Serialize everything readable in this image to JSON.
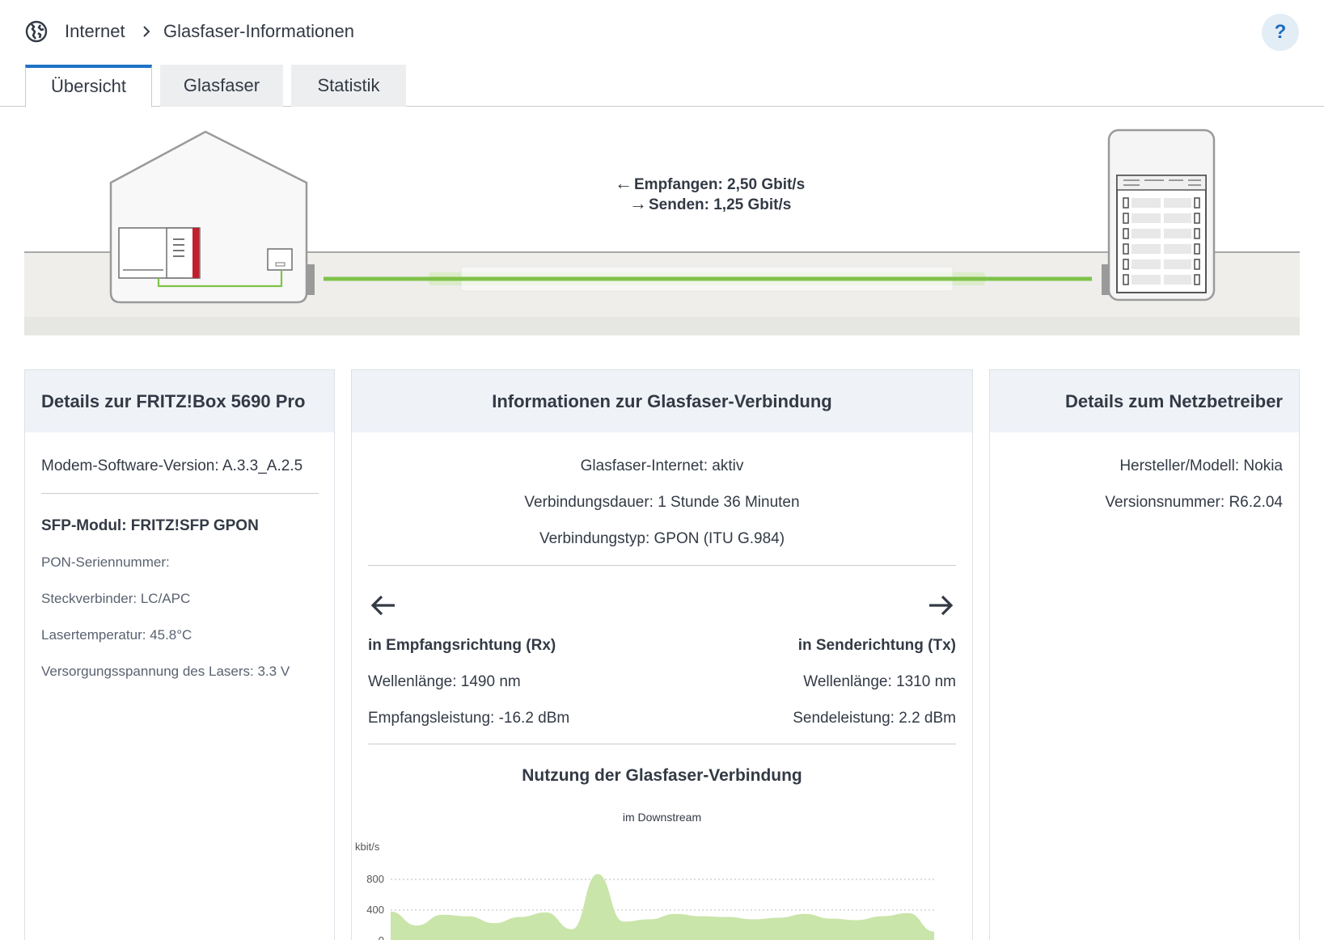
{
  "breadcrumb": {
    "root": "Internet",
    "current": "Glasfaser-Informationen"
  },
  "help_label": "?",
  "tabs": [
    "Übersicht",
    "Glasfaser",
    "Statistik"
  ],
  "diagram": {
    "rx": "Empfangen: 2,50 Gbit/s",
    "tx": "Senden: 1,25 Gbit/s",
    "fiber_color": "#7fc24a",
    "router_accent": "#c0202e"
  },
  "card_left": {
    "title": "Details zur FRITZ!Box 5690 Pro",
    "modem": "Modem-Software-Version: A.3.3_A.2.5",
    "sfp": "SFP-Modul: FRITZ!SFP GPON",
    "pon": "PON-Seriennummer:",
    "connector": "Steckverbinder: LC/APC",
    "laser_temp": "Lasertemperatur: 45.8°C",
    "laser_voltage": "Versorgungsspannung des Lasers: 3.3 V"
  },
  "card_mid": {
    "title": "Informationen zur Glasfaser-Verbindung",
    "status": "Glasfaser-Internet: aktiv",
    "duration": "Verbindungsdauer: 1 Stunde 36 Minuten",
    "type": "Verbindungstyp: GPON (ITU G.984)",
    "rx_title": "in Empfangsrichtung (Rx)",
    "rx_wavelength": "Wellenlänge: 1490 nm",
    "rx_power": "Empfangsleistung: -16.2 dBm",
    "tx_title": "in Senderichtung (Tx)",
    "tx_wavelength": "Wellenlänge: 1310 nm",
    "tx_power": "Sendeleistung: 2.2 dBm",
    "usage_title": "Nutzung der Glasfaser-Verbindung",
    "usage_sub": "im Downstream"
  },
  "card_right": {
    "title": "Details zum Netzbetreiber",
    "vendor": "Hersteller/Modell: Nokia",
    "version": "Versionsnummer: R6.2.04"
  },
  "chart_data": {
    "type": "area",
    "title": "Nutzung der Glasfaser-Verbindung",
    "subtitle": "im Downstream",
    "ylabel": "kbit/s",
    "yticks": [
      "800",
      "400",
      "0"
    ],
    "ylim": [
      0,
      1000
    ],
    "color": "#c9e5a9",
    "values": [
      380,
      200,
      340,
      320,
      230,
      310,
      370,
      150,
      870,
      250,
      280,
      350,
      320,
      310,
      280,
      300,
      350,
      290,
      270,
      320,
      360,
      120
    ]
  }
}
